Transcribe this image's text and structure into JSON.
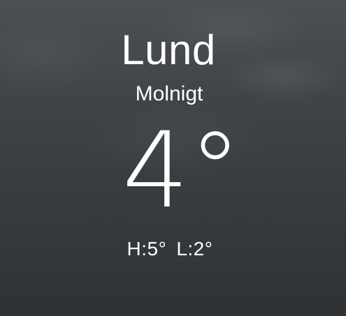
{
  "location": {
    "city": "Lund",
    "condition": "Molnigt"
  },
  "current": {
    "temperature": "4°"
  },
  "range": {
    "high": "H:5°",
    "low": "L:2°"
  },
  "colors": {
    "text": "#ffffff",
    "background_top": "#4c5053",
    "background_bottom": "#2f3235"
  }
}
